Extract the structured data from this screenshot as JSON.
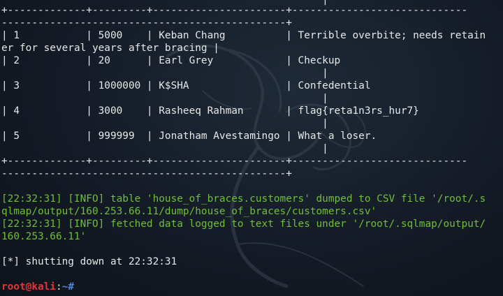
{
  "terminal": {
    "lines": [
      {
        "text": "                                                     |",
        "kind": "output"
      },
      {
        "text": "+-------------+---------+----------------------+-----------------------------",
        "kind": "output"
      },
      {
        "text": "-----------------------------------------------+",
        "kind": "output"
      },
      {
        "text": "| 1           | 5000    | Keban Chang          | Terrible overbite; needs retain",
        "kind": "output"
      },
      {
        "text": "er for several years after bracing |",
        "kind": "output"
      },
      {
        "text": "| 2           | 20      | Earl Grey            | Checkup",
        "kind": "output"
      },
      {
        "text": "                                                     |",
        "kind": "output"
      },
      {
        "text": "| 3           | 1000000 | K$SHA                | Confedential",
        "kind": "output"
      },
      {
        "text": "                                                     |",
        "kind": "output"
      },
      {
        "text": "| 4           | 3000    | Rasheeq Rahman       | flag{reta1n3rs_hur7}",
        "kind": "output"
      },
      {
        "text": "                                                     |",
        "kind": "output"
      },
      {
        "text": "| 5           | 999999  | Jonatham Avestamingo | What a loser.",
        "kind": "output"
      },
      {
        "text": "                                                     |",
        "kind": "output"
      },
      {
        "text": "+-------------+---------+----------------------+-----------------------------",
        "kind": "output"
      },
      {
        "text": "-----------------------------------------------+",
        "kind": "output"
      },
      {
        "text": "",
        "kind": "blank"
      },
      {
        "text": "[22:32:31] [INFO] table 'house_of_braces.customers' dumped to CSV file '/root/.s",
        "kind": "info"
      },
      {
        "text": "qlmap/output/160.253.66.11/dump/house_of_braces/customers.csv'",
        "kind": "info"
      },
      {
        "text": "[22:32:31] [INFO] fetched data logged to text files under '/root/.sqlmap/output/",
        "kind": "info"
      },
      {
        "text": "160.253.66.11'",
        "kind": "info"
      },
      {
        "text": "",
        "kind": "blank"
      },
      {
        "text": "[*] shutting down at 22:32:31",
        "kind": "output"
      },
      {
        "text": "",
        "kind": "blank"
      }
    ],
    "prompt": {
      "user_host": "root@kali",
      "separator": ":",
      "path": "~#",
      "cursor": " "
    }
  },
  "colors": {
    "background": "#141b26",
    "text": "#e8e8e8",
    "info": "#6fbf3a",
    "prompt_user": "#e0363a",
    "prompt_path": "#4f86d8"
  },
  "icons": {
    "background_logo": "kali-dragon-icon"
  }
}
